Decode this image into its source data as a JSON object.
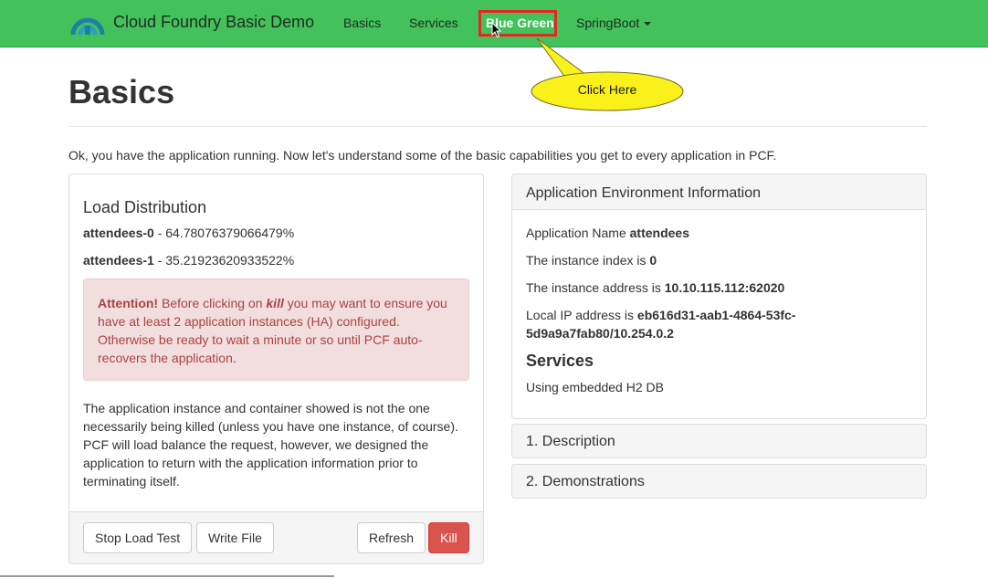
{
  "navbar": {
    "brand": "Cloud Foundry Basic Demo",
    "links": [
      "Basics",
      "Services",
      "Blue Green",
      "SpringBoot"
    ],
    "logo_icon": "cloud-foundry-logo-icon",
    "dropdown_icon": "caret-down-icon",
    "active_link": "Blue Green",
    "bg_color": "#43c15b"
  },
  "annotation": {
    "callout_text": "Click Here",
    "highlight_color": "#e6261f",
    "callout_color": "#fbf11a"
  },
  "page": {
    "title": "Basics",
    "intro": "Ok, you have the application running. Now let's understand some of the basic capabilities you get to every application in PCF."
  },
  "load": {
    "heading": "Load Distribution",
    "items": [
      {
        "name": "attendees-0",
        "value": " - 64.78076379066479%"
      },
      {
        "name": "attendees-1",
        "value": " - 35.21923620933522%"
      }
    ],
    "alert_strong": "Attention!",
    "alert_pre": " Before clicking on ",
    "alert_kill": "kill",
    "alert_post": " you may want to ensure you have at least 2 application instances (HA) configured. Otherwise be ready to wait a minute or so until PCF auto-recovers the application.",
    "body": "The application instance and container showed is not the one necessarily being killed (unless you have one instance, of course). PCF will load balance the request, however, we designed the application to return with the application information prior to terminating itself.",
    "buttons": {
      "stop": "Stop Load Test",
      "write": "Write File",
      "refresh": "Refresh",
      "kill": "Kill"
    }
  },
  "env": {
    "heading": "Application Environment Information",
    "app_name_label": "Application Name ",
    "app_name": "attendees",
    "index_label": "The instance index is ",
    "index": "0",
    "address_label": "The instance address is ",
    "address": "10.10.115.112:62020",
    "ip_label": "Local IP address is ",
    "ip": "eb616d31-aab1-4864-53fc-5d9a9a7fab80/10.254.0.2",
    "services_heading": "Services",
    "services_text": "Using embedded H2 DB"
  },
  "accordion": [
    "1. Description",
    "2. Demonstrations"
  ]
}
